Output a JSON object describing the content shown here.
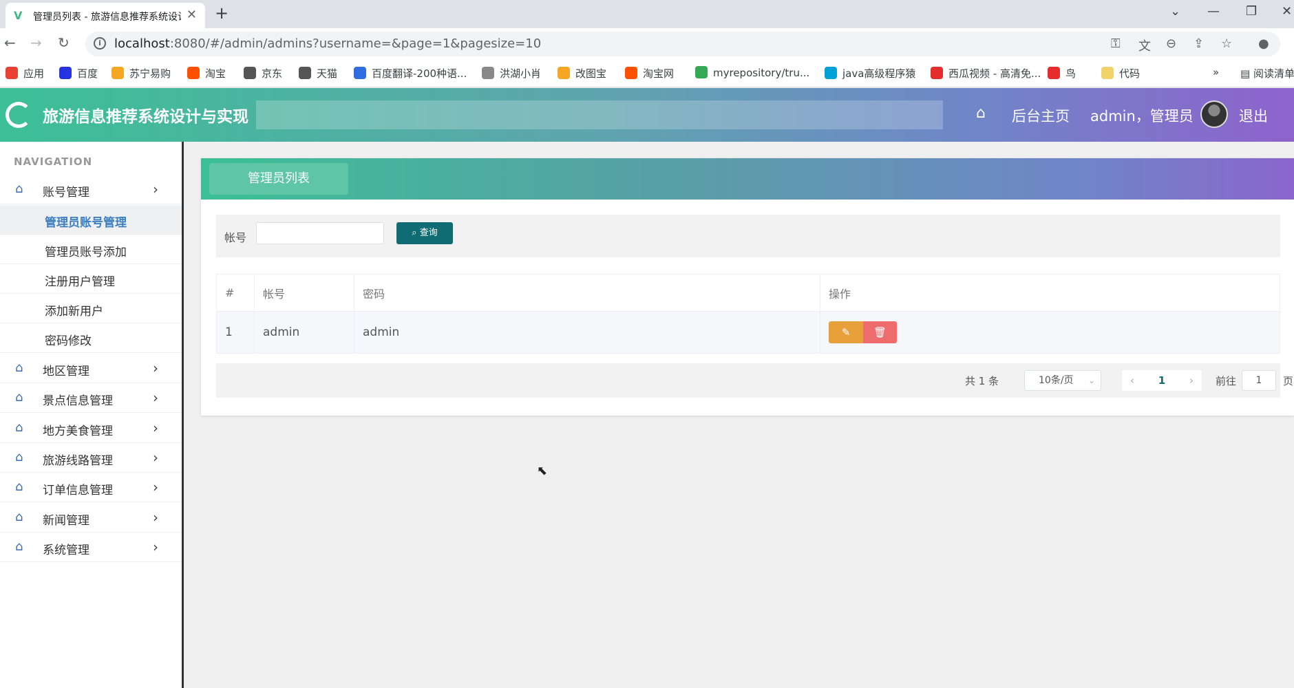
{
  "browser": {
    "tab_title": "管理员列表 - 旅游信息推荐系统设计与实现",
    "url_host": "localhost",
    "url_rest": ":8080/#/admin/admins?username=&page=1&pagesize=10",
    "bookmarks": [
      {
        "label": "应用",
        "color": "#e94235"
      },
      {
        "label": "百度",
        "color": "#2932e1"
      },
      {
        "label": "苏宁易购",
        "color": "#f5a623"
      },
      {
        "label": "淘宝",
        "color": "#ff5000"
      },
      {
        "label": "京东",
        "color": "#555555"
      },
      {
        "label": "天猫",
        "color": "#555555"
      },
      {
        "label": "百度翻译-200种语...",
        "color": "#2f6de1"
      },
      {
        "label": "洪湖小肖",
        "color": "#888888"
      },
      {
        "label": "改图宝",
        "color": "#f5a623"
      },
      {
        "label": "淘宝网",
        "color": "#ff5000"
      },
      {
        "label": "myrepository/tru...",
        "color": "#34a853"
      },
      {
        "label": "java高级程序猿",
        "color": "#00a1d6"
      },
      {
        "label": "西瓜视频 - 高清免...",
        "color": "#e62d2d"
      },
      {
        "label": "鸟",
        "color": "#e62d2d"
      },
      {
        "label": "代码",
        "color": "#f0d36b"
      }
    ],
    "reading_list": "阅读清单"
  },
  "header": {
    "app_title": "旅游信息推荐系统设计与实现",
    "home_label": "后台主页",
    "user_label": "admin，管理员",
    "logout_label": "退出"
  },
  "sidebar": {
    "nav_label": "NAVIGATION",
    "account_group": "账号管理",
    "account_items": [
      "管理员账号管理",
      "管理员账号添加",
      "注册用户管理",
      "添加新用户",
      "密码修改"
    ],
    "groups": [
      "地区管理",
      "景点信息管理",
      "地方美食管理",
      "旅游线路管理",
      "订单信息管理",
      "新闻管理",
      "系统管理"
    ]
  },
  "main": {
    "card_title": "管理员列表",
    "search": {
      "label": "帐号",
      "value": "",
      "button": "查询"
    },
    "table": {
      "headers": [
        "#",
        "帐号",
        "密码",
        "操作"
      ],
      "rows": [
        {
          "index": "1",
          "username": "admin",
          "password": "admin"
        }
      ]
    },
    "pager": {
      "total": "共 1 条",
      "page_size": "10条/页",
      "current_page": "1",
      "goto_label": "前往",
      "goto_value": "1",
      "page_unit": "页"
    }
  }
}
